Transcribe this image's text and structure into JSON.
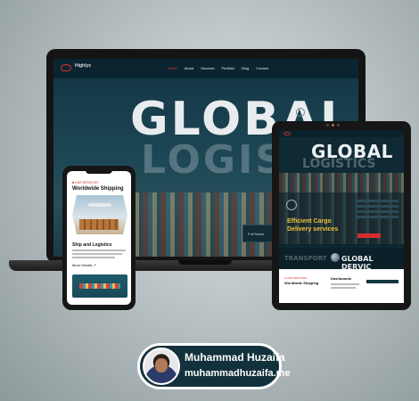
{
  "laptop": {
    "brand": "Highlyx",
    "nav": [
      "Home",
      "About",
      "Services",
      "Portfolio",
      "Blog",
      "Contact"
    ],
    "hero_title": "GLOBAL",
    "hero_subtitle": "LOGISTIC",
    "card_label": "Full Name"
  },
  "tablet": {
    "hero_title": "GLOBAL",
    "hero_subtitle": "LOGISTICS",
    "cargo_text": "Efficient Cargo Delivery services",
    "band_left": "TRANSPORT",
    "band_right": "GLOBAL DERVIC",
    "section_kicker": "● OUR SERVICES",
    "section_title": "Worldwide Shipping",
    "side_title": "Dashboards"
  },
  "phone": {
    "kicker": "■ OUR SERVICES",
    "title": "Worldwide Shipping",
    "item_title": "Ship and Logistics",
    "more_link": "More Details ↗"
  },
  "author": {
    "name": "Muhammad Huzaifa",
    "website": "muhammadhuzaifa.me"
  },
  "colors": {
    "accent_red": "#d62d2d",
    "navy": "#0f2a34",
    "cargo_yellow": "#f0c33a"
  }
}
